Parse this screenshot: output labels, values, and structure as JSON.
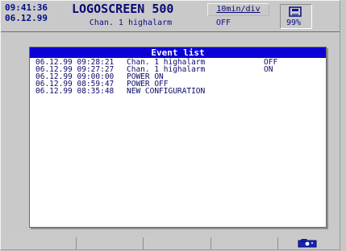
{
  "header": {
    "time": "09:41:36",
    "date": "06.12.99",
    "brand": "LOGOSCREEN 500",
    "timebase": "10min/div",
    "status_channel": "Chan. 1 highalarm",
    "status_state": "OFF",
    "memory_percent": "99%"
  },
  "dialog": {
    "title": "Event list",
    "events": [
      {
        "date": "06.12.99",
        "time": "09:28:21",
        "message": "Chan. 1 highalarm",
        "status": "OFF"
      },
      {
        "date": "06.12.99",
        "time": "09:27:27",
        "message": "Chan. 1 highalarm",
        "status": "ON"
      },
      {
        "date": "06.12.99",
        "time": "09:00:00",
        "message": "POWER ON",
        "status": ""
      },
      {
        "date": "06.12.99",
        "time": "08:59:47",
        "message": "POWER OFF",
        "status": ""
      },
      {
        "date": "06.12.99",
        "time": "08:35:48",
        "message": "NEW CONFIGURATION",
        "status": ""
      }
    ]
  },
  "softkeys": {
    "camera_icon": "camera-icon"
  },
  "colors": {
    "accent_blue": "#0b00d6",
    "text_blue": "#0a0a75",
    "background": "#c9c9c9"
  }
}
